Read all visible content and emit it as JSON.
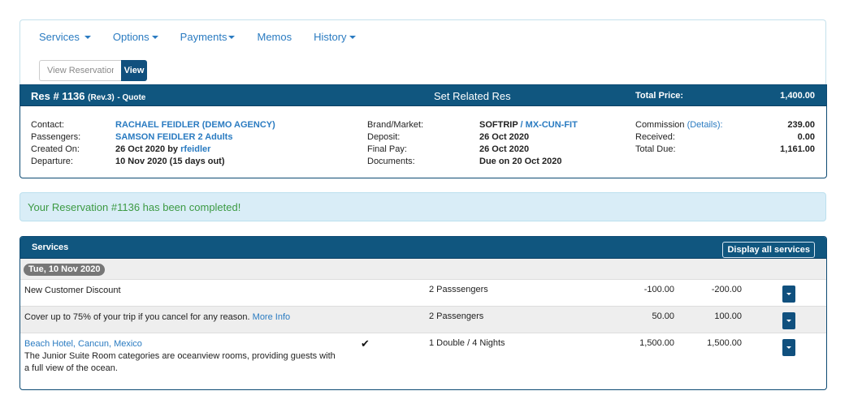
{
  "nav": {
    "items": [
      {
        "label": "Services",
        "has_dropdown": true
      },
      {
        "label": "Options",
        "has_dropdown": true
      },
      {
        "label": "Payments",
        "has_dropdown": true
      },
      {
        "label": "Memos",
        "has_dropdown": false
      },
      {
        "label": "History",
        "has_dropdown": true
      }
    ],
    "view_input_placeholder": "View Reservation",
    "view_button_label": "View"
  },
  "reservation": {
    "title": "Res # 1136",
    "revision": "(Rev.3)",
    "status": "- Quote",
    "related_label": "Set Related Res",
    "total_price_label": "Total Price:",
    "total_price_value": "1,400.00",
    "left": {
      "contact_label": "Contact:",
      "contact_value": "RACHAEL FEIDLER (DEMO AGENCY)",
      "passengers_label": "Passengers:",
      "passengers_value": "SAMSON FEIDLER 2 Adults",
      "created_label": "Created On:",
      "created_date": "26 Oct 2020 by",
      "created_by": "rfeidler",
      "departure_label": "Departure:",
      "departure_value": "10 Nov 2020 (15 days out)"
    },
    "middle": {
      "brand_label": "Brand/Market:",
      "brand_value": "SOFTRIP",
      "brand_sep": " / ",
      "market_value": "MX-CUN-FIT",
      "deposit_label": "Deposit:",
      "deposit_value": "26 Oct 2020",
      "finalpay_label": "Final Pay:",
      "finalpay_value": "26 Oct 2020",
      "documents_label": "Documents:",
      "documents_value": "Due on 20 Oct 2020"
    },
    "right": {
      "commission_label": "Commission",
      "commission_details": "(Details)",
      "commission_colon": ":",
      "commission_value": "239.00",
      "received_label": "Received:",
      "received_value": "0.00",
      "total_due_label": "Total Due:",
      "total_due_value": "1,161.00"
    }
  },
  "alert": {
    "message": "Your Reservation #1136 has been completed!"
  },
  "services": {
    "title": "Services",
    "display_all_label": "Display all services",
    "date_badge": "Tue, 10 Nov 2020",
    "rows": [
      {
        "description": "New Customer Discount",
        "link": "",
        "link_text": "",
        "checked": false,
        "quantity": "2 Passsengers",
        "unit_price": "-100.00",
        "total": "-200.00"
      },
      {
        "description": "Cover up to 75% of your trip if you cancel for any reason. ",
        "link_text": "More Info",
        "checked": false,
        "quantity": "2 Passengers",
        "unit_price": "50.00",
        "total": "100.00"
      },
      {
        "title": "Beach Hotel, Cancun, Mexico",
        "description": "The Junior Suite Room categories are oceanview rooms, providing guests with a full view of the ocean.",
        "checked": true,
        "check_icon": "✔",
        "quantity": "1 Double / 4 Nights",
        "unit_price": "1,500.00",
        "total": "1,500.00"
      }
    ]
  }
}
